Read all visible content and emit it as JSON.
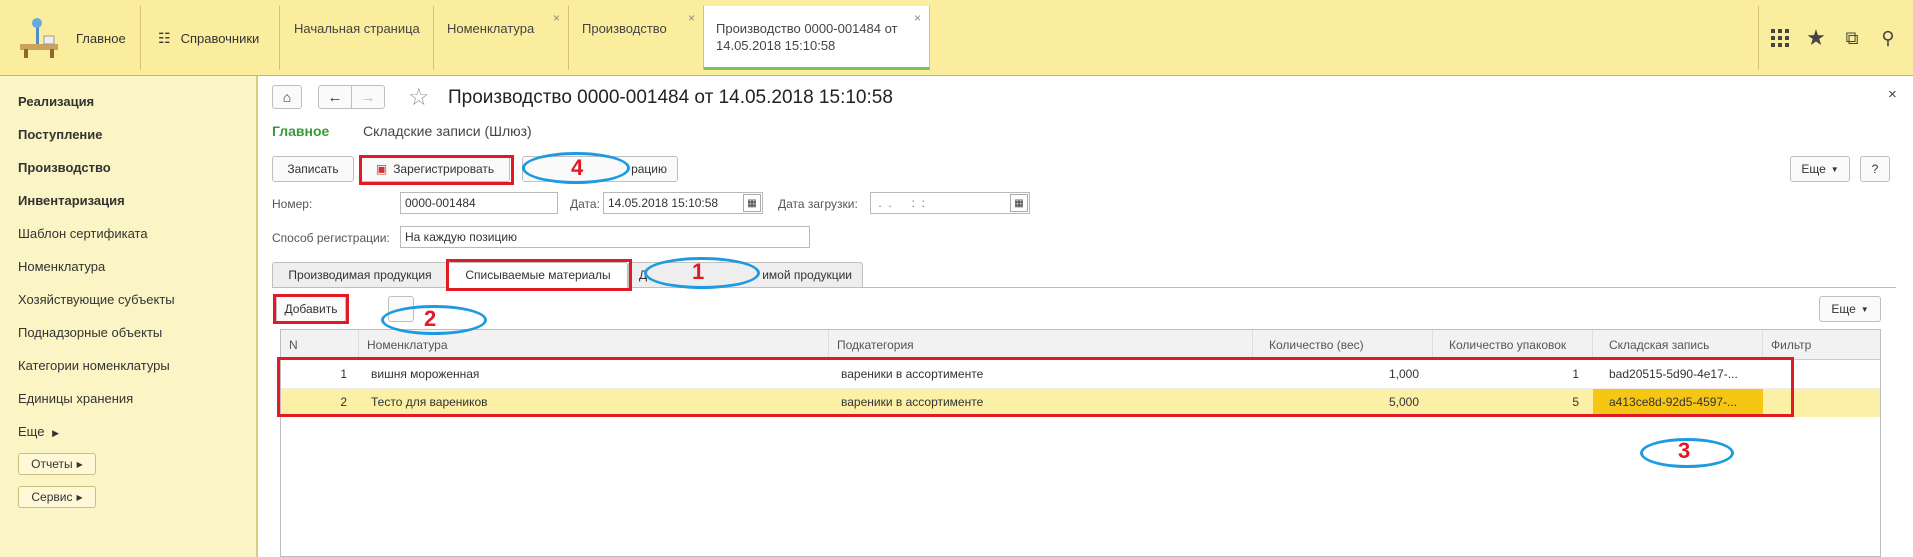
{
  "topbar": {
    "home_label": "Главное",
    "catalogs_label": "Справочники",
    "tabs": [
      {
        "label": "Начальная страница"
      },
      {
        "label": "Номенклатура"
      },
      {
        "label": "Производство"
      },
      {
        "label": "Производство 0000-001484 от 14.05.2018 15:10:58"
      }
    ]
  },
  "sidebar": {
    "items": [
      "Реализация",
      "Поступление",
      "Производство",
      "Инвентаризация",
      "Шаблон сертификата",
      "Номенклатура",
      "Хозяйствующие субъекты",
      "Поднадзорные объекты",
      "Категории номенклатуры",
      "Единицы хранения",
      "Еще"
    ],
    "reports_label": "Отчеты",
    "service_label": "Сервис"
  },
  "document": {
    "title": "Производство 0000-001484 от 14.05.2018 15:10:58",
    "nav_main": "Главное",
    "nav_link": "Складские записи (Шлюз)",
    "btn_write": "Записать",
    "btn_register": "Зарегистрировать",
    "btn_cancel_reg_visible": "рацию",
    "btn_more": "Еще",
    "btn_help": "?",
    "number_label": "Номер:",
    "number_value": "0000-001484",
    "date_label": "Дата:",
    "date_value": "14.05.2018 15:10:58",
    "load_date_label": "Дата загрузки:",
    "load_date_value": " .  .      :  :",
    "reg_method_label": "Способ регистрации:",
    "reg_method_value": "На каждую позицию"
  },
  "tabs": {
    "produced": "Производимая продукция",
    "written_off": "Списываемые материалы",
    "third_prefix": "Д",
    "third_suffix": "имой продукции"
  },
  "table": {
    "add_label": "Добавить",
    "more_label": "Еще",
    "columns": [
      "N",
      "Номенклатура",
      "Подкатегория",
      "Количество (вес)",
      "Количество упаковок",
      "Складская запись",
      "Фильтр"
    ],
    "rows": [
      {
        "n": "1",
        "nom": "вишня мороженная",
        "sub": "вареники в ассортименте",
        "weight": "1,000",
        "packs": "1",
        "record": "bad20515-5d90-4e17-...",
        "filter": ""
      },
      {
        "n": "2",
        "nom": "Тесто для вареников",
        "sub": "вареники в ассортименте",
        "weight": "5,000",
        "packs": "5",
        "record": "a413ce8d-92d5-4597-...",
        "filter": ""
      }
    ]
  },
  "annotations": {
    "m1": "1",
    "m2": "2",
    "m3": "3",
    "m4": "4"
  },
  "colors": {
    "topbar": "#fbed9e",
    "sidebar": "#fbf4c5",
    "selected_row": "#fbf0a6",
    "selected_cell": "#f5c614",
    "mark_red": "#e11b25",
    "mark_blue": "#1e9ae0",
    "accent_green": "#3a9a3a"
  }
}
